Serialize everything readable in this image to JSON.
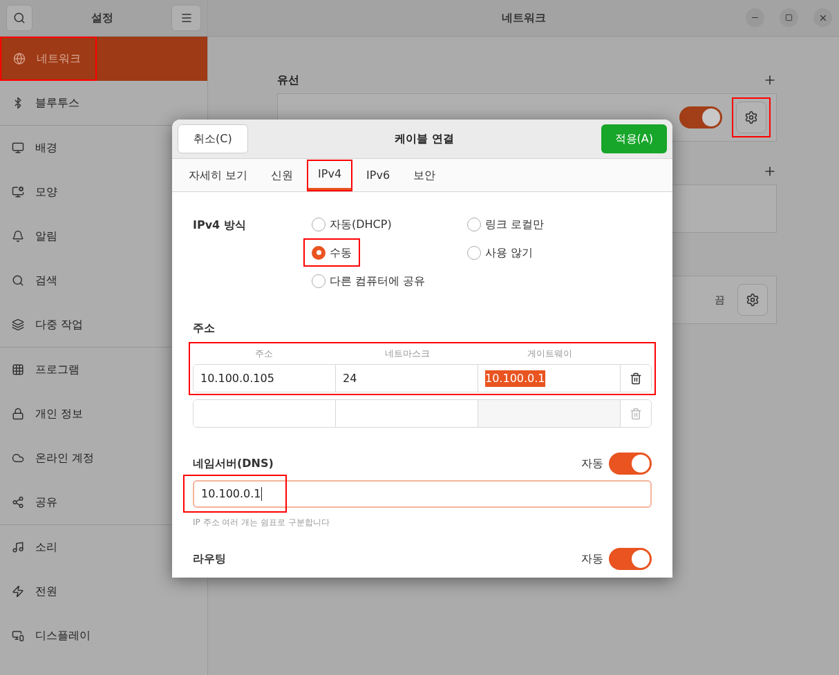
{
  "window": {
    "sidebar_title": "설정",
    "title": "네트워크"
  },
  "sidebar": {
    "groups": [
      [
        {
          "label": "네트워크",
          "selected": true,
          "highlighted": true
        },
        {
          "label": "블루투스",
          "selected": false,
          "highlighted": false
        }
      ],
      [
        {
          "label": "배경",
          "selected": false,
          "highlighted": false
        },
        {
          "label": "모양",
          "selected": false,
          "highlighted": false
        },
        {
          "label": "알림",
          "selected": false,
          "highlighted": false
        },
        {
          "label": "검색",
          "selected": false,
          "highlighted": false
        },
        {
          "label": "다중 작업",
          "selected": false,
          "highlighted": false
        }
      ],
      [
        {
          "label": "프로그램",
          "selected": false,
          "highlighted": false
        },
        {
          "label": "개인 정보",
          "selected": false,
          "highlighted": false
        },
        {
          "label": "온라인 계정",
          "selected": false,
          "highlighted": false
        },
        {
          "label": "공유",
          "selected": false,
          "highlighted": false
        }
      ],
      [
        {
          "label": "소리",
          "selected": false,
          "highlighted": false
        },
        {
          "label": "전원",
          "selected": false,
          "highlighted": false
        },
        {
          "label": "디스플레이",
          "selected": false,
          "highlighted": false
        }
      ]
    ]
  },
  "network": {
    "sections": [
      {
        "title": "유선",
        "cards": [
          {
            "kind": "toggle",
            "on": true,
            "gear_highlighted": true
          }
        ]
      },
      {
        "cards": [
          {
            "kind": "empty"
          }
        ]
      },
      {
        "cards": [
          {
            "kind": "status",
            "status": "끔",
            "gear_highlighted": false
          }
        ]
      }
    ]
  },
  "dialog": {
    "title": "케이블 연결",
    "cancel": "취소(C)",
    "apply": "적용(A)",
    "tabs": [
      {
        "label": "자세히 보기",
        "selected": false,
        "highlighted": false
      },
      {
        "label": "신원",
        "selected": false,
        "highlighted": false
      },
      {
        "label": "IPv4",
        "selected": true,
        "highlighted": true
      },
      {
        "label": "IPv6",
        "selected": false,
        "highlighted": false
      },
      {
        "label": "보안",
        "selected": false,
        "highlighted": false
      }
    ],
    "method": {
      "label": "IPv4 방식",
      "options": [
        {
          "label": "자동(DHCP)",
          "selected": false,
          "highlighted": false
        },
        {
          "label": "링크 로컬만",
          "selected": false,
          "highlighted": false
        },
        {
          "label": "수동",
          "selected": true,
          "highlighted": true
        },
        {
          "label": "사용 않기",
          "selected": false,
          "highlighted": false
        },
        {
          "label": "다른 컴퓨터에 공유",
          "selected": false,
          "highlighted": false
        }
      ]
    },
    "address": {
      "title": "주소",
      "columns": [
        "주소",
        "네트마스크",
        "게이트웨이"
      ],
      "highlighted": true,
      "rows": [
        {
          "kind": "filled",
          "cells": [
            {
              "value": "10.100.0.105",
              "text_selected": false
            },
            {
              "value": "24",
              "text_selected": false
            },
            {
              "value": "10.100.0.1",
              "text_selected": true
            }
          ]
        },
        {
          "kind": "blank"
        }
      ]
    },
    "dns": {
      "title": "네임서버(DNS)",
      "auto_label": "자동",
      "auto": true,
      "value": "10.100.0.1",
      "focused": true,
      "highlighted": true,
      "hint": "IP 주소 여러 개는 쉼표로 구분합니다"
    },
    "routing": {
      "title": "라우팅",
      "auto_label": "자동",
      "auto": true
    }
  }
}
